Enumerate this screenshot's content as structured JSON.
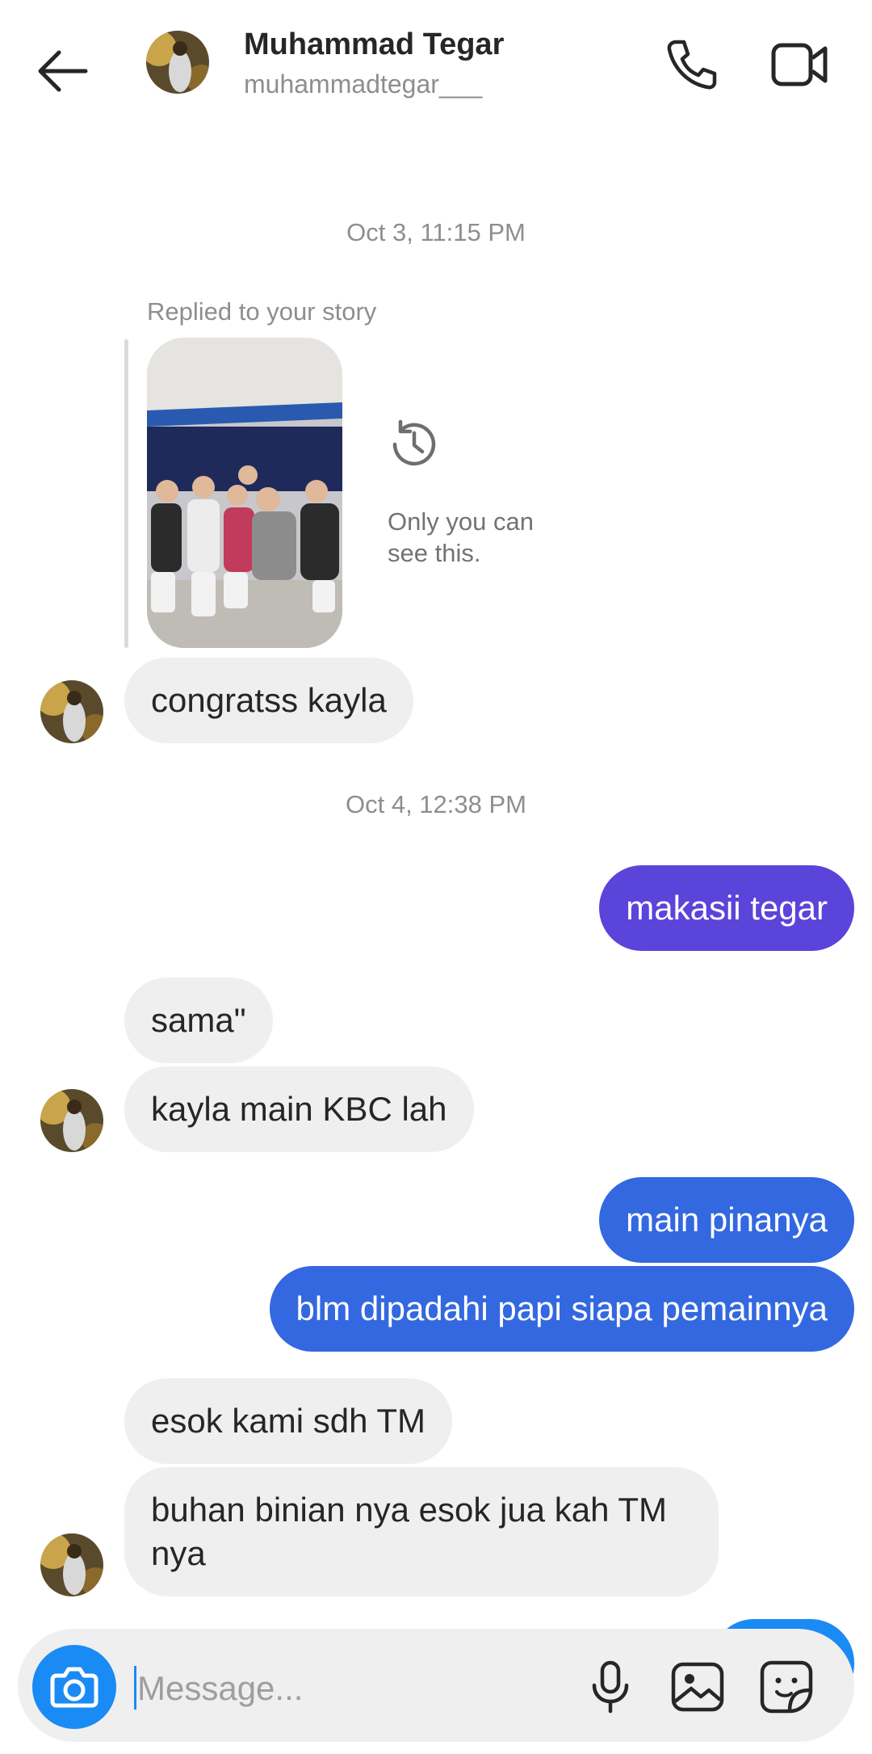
{
  "header": {
    "name": "Muhammad Tegar",
    "username": "muhammadtegar___"
  },
  "icons": {
    "back": "arrow-left-icon",
    "call": "phone-icon",
    "video": "video-camera-icon",
    "history": "story-history-icon",
    "camera": "camera-icon",
    "mic": "microphone-icon",
    "gallery": "image-icon",
    "sticker": "sticker-icon"
  },
  "colors": {
    "accent": "#1a8af5",
    "incoming_bubble": "#efefef",
    "outgoing_purple": "#5b44d9",
    "outgoing_blue": "#3368e0",
    "timestamp": "#8e8e8e"
  },
  "thread": {
    "timestamp_1": "Oct 3, 11:15 PM",
    "story_reply": {
      "label": "Replied to your story",
      "note": "Only you can see this."
    },
    "msg_congrats": "congratss kayla",
    "timestamp_2": "Oct 4, 12:38 PM",
    "msg_makasii": "makasii tegar",
    "msg_sama": "sama\"",
    "msg_kayla_kbc": "kayla main KBC lah",
    "msg_main_pinanya": "main pinanya",
    "msg_blm": "blm dipadahi papi siapa pemainnya",
    "msg_esok": "esok kami sdh TM",
    "msg_buhan_line1": "buhan binian nya esok jua kah TM",
    "msg_buhan_line2": "nya"
  },
  "composer": {
    "placeholder": "Message..."
  }
}
